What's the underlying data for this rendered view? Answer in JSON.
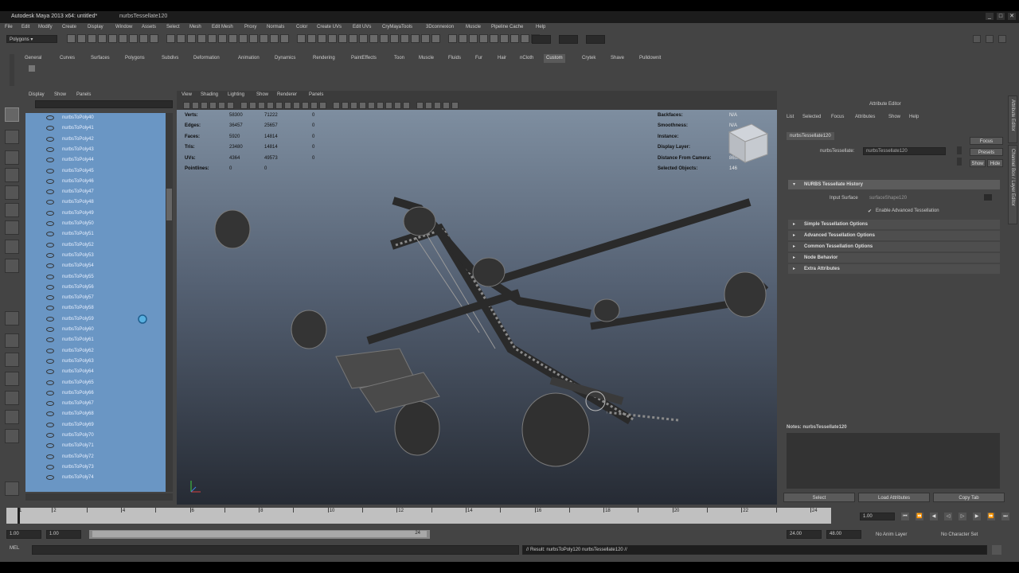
{
  "window": {
    "title": "Autodesk Maya 2013 x64: untitled*",
    "node": "nurbsTessellate120",
    "controls": [
      "_",
      "□",
      "✕"
    ]
  },
  "menubar": [
    "File",
    "Edit",
    "Modify",
    "Create",
    "Display",
    "Window",
    "Assets",
    "Select",
    "Mesh",
    "Edit Mesh",
    "Proxy",
    "Normals",
    "Color",
    "Create UVs",
    "Edit UVs",
    "CryMayaTools",
    "3Dconnexion",
    "Muscle",
    "Pipeline Cache",
    "Help"
  ],
  "status_line": {
    "mode": "Polygons ▾"
  },
  "shelf_tabs": [
    "General",
    "Curves",
    "Surfaces",
    "Polygons",
    "Subdivs",
    "Deformation",
    "Animation",
    "Dynamics",
    "Rendering",
    "PaintEffects",
    "Toon",
    "Muscle",
    "Fluids",
    "Fur",
    "Hair",
    "nCloth",
    "Custom",
    "Crytek",
    "Shave",
    "Pulldownit"
  ],
  "shelf_active": "Custom",
  "outliner": {
    "menu": [
      "Display",
      "Show",
      "Panels"
    ],
    "items": [
      "nurbsToPoly40",
      "nurbsToPoly41",
      "nurbsToPoly42",
      "nurbsToPoly43",
      "nurbsToPoly44",
      "nurbsToPoly45",
      "nurbsToPoly46",
      "nurbsToPoly47",
      "nurbsToPoly48",
      "nurbsToPoly49",
      "nurbsToPoly50",
      "nurbsToPoly51",
      "nurbsToPoly52",
      "nurbsToPoly53",
      "nurbsToPoly54",
      "nurbsToPoly55",
      "nurbsToPoly56",
      "nurbsToPoly57",
      "nurbsToPoly58",
      "nurbsToPoly59",
      "nurbsToPoly60",
      "nurbsToPoly61",
      "nurbsToPoly62",
      "nurbsToPoly63",
      "nurbsToPoly64",
      "nurbsToPoly65",
      "nurbsToPoly66",
      "nurbsToPoly67",
      "nurbsToPoly68",
      "nurbsToPoly69",
      "nurbsToPoly70",
      "nurbsToPoly71",
      "nurbsToPoly72",
      "nurbsToPoly73",
      "nurbsToPoly74"
    ]
  },
  "viewport": {
    "menu": [
      "View",
      "Shading",
      "Lighting",
      "Show",
      "Renderer",
      "Panels"
    ],
    "hud_left": [
      {
        "label": "Verts:",
        "a": "58300",
        "b": "71222",
        "c": "0"
      },
      {
        "label": "Edges:",
        "a": "36457",
        "b": "25657",
        "c": "0"
      },
      {
        "label": "Faces:",
        "a": "5920",
        "b": "14814",
        "c": "0"
      },
      {
        "label": "Tris:",
        "a": "23480",
        "b": "14814",
        "c": "0"
      },
      {
        "label": "UVs:",
        "a": "4364",
        "b": "49573",
        "c": "0"
      },
      {
        "label": "Pointlines:",
        "a": "0",
        "b": "0",
        "c": ""
      }
    ],
    "hud_right": [
      {
        "label": "Backfaces:",
        "value": "N/A"
      },
      {
        "label": "Smoothness:",
        "value": "N/A"
      },
      {
        "label": "Instance:",
        "value": "N/A"
      },
      {
        "label": "Display Layer:",
        "value": "N/A"
      },
      {
        "label": "Distance From Camera:",
        "value": "865.745"
      },
      {
        "label": "Selected Objects:",
        "value": "146"
      }
    ]
  },
  "attribute_editor": {
    "title": "Attribute Editor",
    "menu": [
      "List",
      "Selected",
      "Focus",
      "Attributes",
      "Show",
      "Help"
    ],
    "node_tab": "nurbsTessellate120",
    "node_label": "nurbsTessellate:",
    "node_value": "nurbsTessellate120",
    "buttons": {
      "focus": "Focus",
      "presets": "Presets",
      "show": "Show",
      "hide": "Hide"
    },
    "history_section": "NURBS Tessellate History",
    "input_surface_label": "Input Surface",
    "input_surface_value": "surfaceShape120",
    "enable_advanced": "Enable Advanced Tessellation",
    "sections": [
      "Simple Tessellation Options",
      "Advanced Tessellation Options",
      "Common Tessellation Options",
      "Node Behavior",
      "Extra Attributes"
    ],
    "notes_label": "Notes: nurbsTessellate120",
    "bottom_buttons": [
      "Select",
      "Load Attributes",
      "Copy Tab"
    ]
  },
  "side_tabs": [
    "Attribute Editor",
    "Channel Box / Layer Editor"
  ],
  "time_slider": {
    "ticks": [
      "1",
      "2",
      "4",
      "6",
      "8",
      "10",
      "12",
      "14",
      "16",
      "18",
      "20",
      "22",
      "24"
    ],
    "current": "1.00"
  },
  "range": {
    "start": "1.00",
    "start2": "1.00",
    "mid": "24",
    "end": "24.00",
    "end2": "48.00",
    "anim_layer": "No Anim Layer",
    "char_set": "No Character Set"
  },
  "cmd": {
    "label": "MEL",
    "output": "// Result: nurbsToPoly120 nurbsTessellate120 //"
  }
}
